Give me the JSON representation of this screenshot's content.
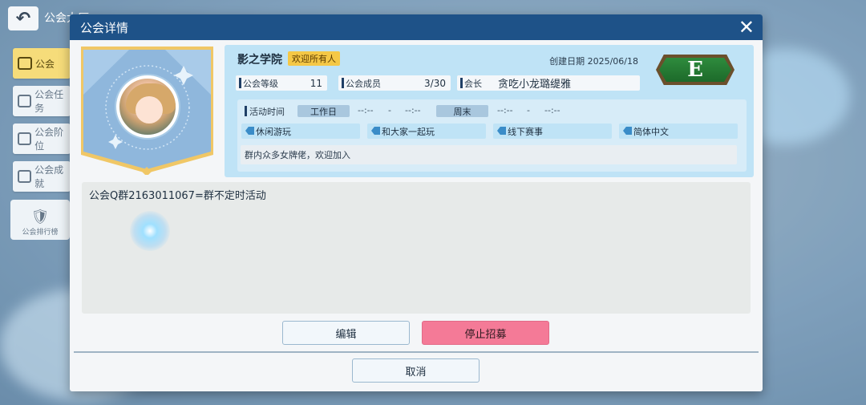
{
  "background": {
    "page_title": "公会大厅",
    "side_menu": [
      {
        "label": "公会",
        "active": true
      },
      {
        "label": "公会任务",
        "active": false
      },
      {
        "label": "公会阶位",
        "active": false
      },
      {
        "label": "公会成就",
        "active": false
      }
    ],
    "rank_label": "公会排行榜"
  },
  "dialog": {
    "title": "公会详情",
    "close_icon": "close-icon"
  },
  "guild": {
    "name": "影之学院",
    "welcome_badge": "欢迎所有人",
    "created_label": "创建日期",
    "created_date": "2025/06/18",
    "grade": "E",
    "stats": {
      "level_label": "公会等级",
      "level_value": "11",
      "members_label": "公会成员",
      "members_value": "3/30",
      "leader_label": "会长",
      "leader_value": "贪吃小龙璐缇雅"
    },
    "activity": {
      "label": "活动时间",
      "weekday_label": "工作日",
      "weekday_start": "--:--",
      "weekday_sep": "-",
      "weekday_end": "--:--",
      "weekend_label": "周末",
      "weekend_start": "--:--",
      "weekend_sep": "-",
      "weekend_end": "--:--"
    },
    "tags": [
      "休闲游玩",
      "和大家一起玩",
      "线下赛事",
      "简体中文"
    ],
    "description": "群内众多女牌佬，欢迎加入"
  },
  "notice": {
    "text": "公会Q群2163011067=群不定时活动"
  },
  "buttons": {
    "edit": "编辑",
    "stop_recruit": "停止招募",
    "cancel": "取消"
  },
  "colors": {
    "header": "#1e5288",
    "info_card": "#bfe3f6",
    "badge": "#f5c846",
    "stop_button": "#f47a97",
    "grade_badge": "#2e8b3d"
  }
}
